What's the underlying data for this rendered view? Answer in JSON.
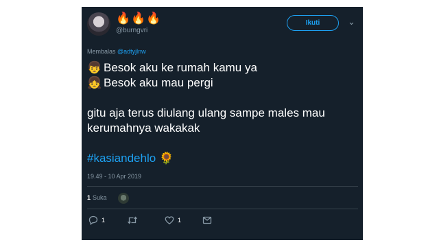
{
  "tweet": {
    "display_name": "🔥🔥🔥",
    "handle": "@burngvri",
    "follow_label": "Ikuti",
    "reply_prefix": "Membalas",
    "reply_mention": "@adtyjlnw",
    "lines": [
      {
        "emoji": "👦",
        "text": "Besok aku ke rumah kamu ya"
      },
      {
        "emoji": "👧",
        "text": "Besok aku mau pergi"
      }
    ],
    "paragraph_1": "gitu aja terus diulang ulang sampe males mau",
    "paragraph_2": "kerumahnya wakakak",
    "hashtag": "#kasiandehlo",
    "hashtag_emoji": "🌻",
    "timestamp": "19.49 - 10 Apr 2019",
    "likes_count": "1",
    "likes_label": "Suka",
    "reply_count": "1",
    "like_count": "1"
  },
  "icons": {
    "avatar": "avatar",
    "chevron": "chevron-down-icon",
    "reply": "reply-icon",
    "retweet": "retweet-icon",
    "like": "heart-icon",
    "share": "dm-icon"
  },
  "colors": {
    "background": "#15202b",
    "accent": "#1da1f2",
    "muted": "#8899a6",
    "divider": "#38444d"
  }
}
